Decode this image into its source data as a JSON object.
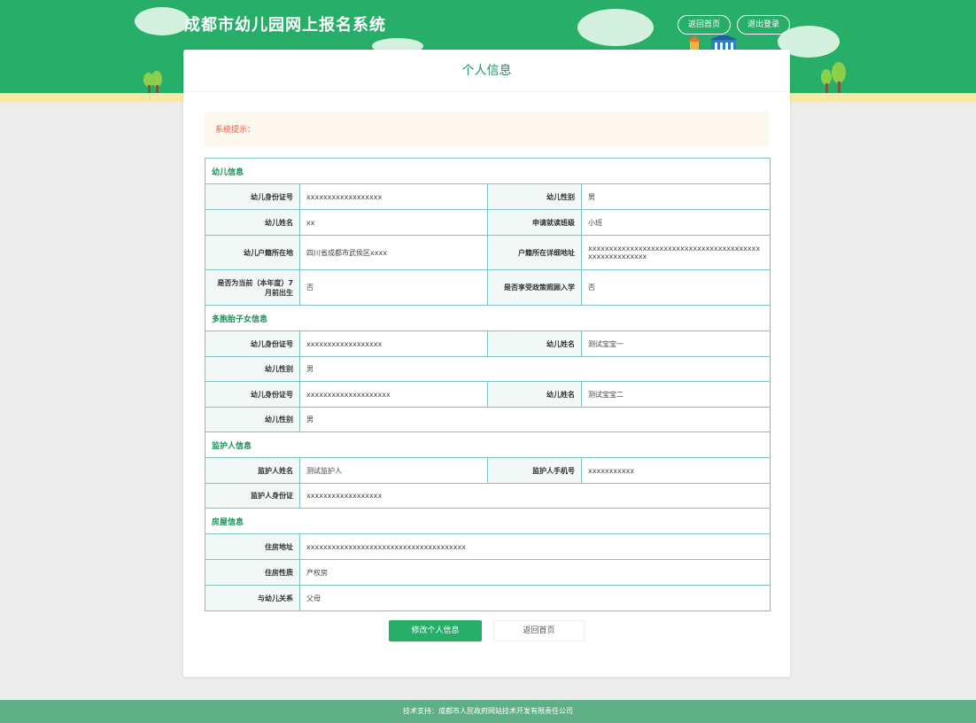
{
  "header": {
    "site_title": "成都市幼儿园网上报名系统",
    "buttons": [
      "返回首页",
      "退出登录"
    ]
  },
  "card": {
    "title": "个人信息",
    "tip_label": "系统提示："
  },
  "sections": [
    {
      "title": "幼儿信息",
      "rows": [
        [
          {
            "label": "幼儿身份证号",
            "value": "xxxxxxxxxxxxxxxxxx"
          },
          {
            "label": "幼儿性别",
            "value": "男"
          }
        ],
        [
          {
            "label": "幼儿姓名",
            "value": "xx"
          },
          {
            "label": "申请就读班级",
            "value": "小班"
          }
        ],
        [
          {
            "label": "幼儿户籍所在地",
            "value": "四川省成都市武侯区xxxx"
          },
          {
            "label": "户籍所在详细地址",
            "value": "xxxxxxxxxxxxxxxxxxxxxxxxxxxxxxxxxxxxxxxxxxxxxxxxxxxxxxx"
          }
        ],
        [
          {
            "label": "是否为当前（本年度）7月前出生",
            "value": "否"
          },
          {
            "label": "是否享受政策照顾入学",
            "value": "否"
          }
        ]
      ]
    },
    {
      "title": "多胞胎子女信息",
      "rows": [
        [
          {
            "label": "幼儿身份证号",
            "value": "xxxxxxxxxxxxxxxxxx"
          },
          {
            "label": "幼儿姓名",
            "value": "测试宝宝一"
          }
        ],
        [
          {
            "label": "幼儿性别",
            "value": "男"
          }
        ],
        [
          {
            "label": "幼儿身份证号",
            "value": "xxxxxxxxxxxxxxxxxxxx"
          },
          {
            "label": "幼儿姓名",
            "value": "测试宝宝二"
          }
        ],
        [
          {
            "label": "幼儿性别",
            "value": "男"
          }
        ]
      ]
    },
    {
      "title": "监护人信息",
      "rows": [
        [
          {
            "label": "监护人姓名",
            "value": "测试监护人"
          },
          {
            "label": "监护人手机号",
            "value": "xxxxxxxxxxx"
          }
        ],
        [
          {
            "label": "监护人身份证",
            "value": "xxxxxxxxxxxxxxxxxx"
          }
        ]
      ]
    },
    {
      "title": "房屋信息",
      "rows": [
        [
          {
            "label": "住房地址",
            "value": "xxxxxxxxxxxxxxxxxxxxxxxxxxxxxxxxxxxxxx"
          }
        ],
        [
          {
            "label": "住房性质",
            "value": "产权房"
          }
        ],
        [
          {
            "label": "与幼儿关系",
            "value": "父母"
          }
        ]
      ]
    }
  ],
  "actions": {
    "primary": "修改个人信息",
    "secondary": "返回首页"
  },
  "footer": {
    "text": "技术支持：成都市人民政府网站技术开发有限责任公司"
  },
  "colors": {
    "brand_green": "#27ae68",
    "table_border": "#7fc1bc",
    "section_title": "#1e8c5a",
    "tip_red": "#e05a47"
  }
}
